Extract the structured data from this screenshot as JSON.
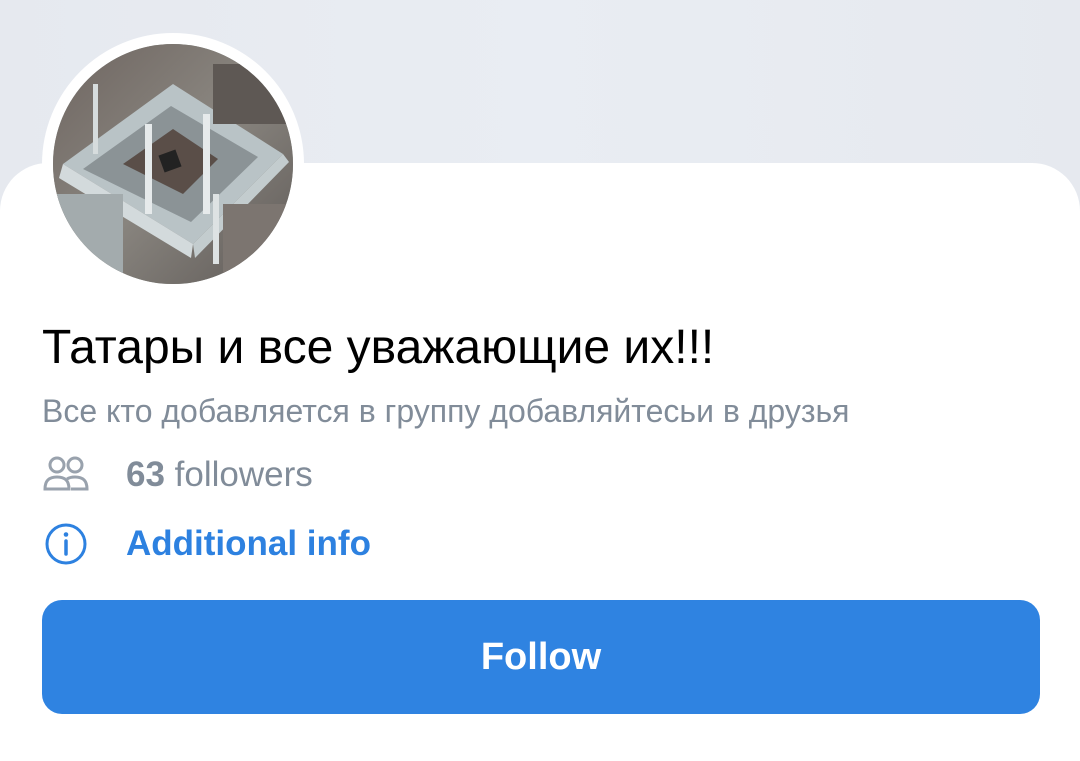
{
  "community": {
    "name": "Татары и все уважающие их!!!",
    "description": "Все кто добавляется в группу добавляйтесьи в друзья",
    "avatar_alt": "",
    "followers_count": "63",
    "followers_label": "followers",
    "additional_info_label": "Additional info",
    "follow_label": "Follow"
  },
  "icons": {
    "followers": "users-icon",
    "info": "info-icon"
  },
  "colors": {
    "accent": "#2f83e1",
    "link": "#2d81e0",
    "secondary_text": "#818c99",
    "title_text": "#000000",
    "background": "#e4e8ee",
    "card": "#ffffff"
  }
}
